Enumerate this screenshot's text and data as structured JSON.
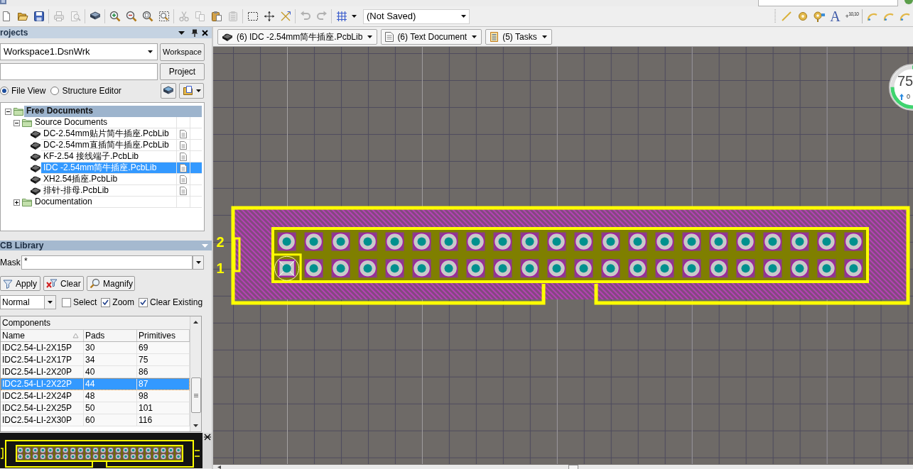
{
  "toolbar": {
    "buttons": [
      {
        "disabled": false
      },
      {
        "disabled": false
      },
      {
        "disabled": false
      },
      {
        "disabled": true
      },
      {
        "disabled": true
      },
      {
        "disabled": false
      },
      {
        "disabled": false
      },
      {
        "disabled": false
      },
      {
        "disabled": false
      },
      {
        "disabled": false
      },
      {
        "disabled": true
      },
      {
        "disabled": true
      },
      {
        "disabled": false
      },
      {
        "disabled": true
      },
      {
        "disabled": false
      },
      {
        "disabled": false
      },
      {
        "disabled": false
      },
      {
        "disabled": true
      },
      {
        "disabled": true
      },
      {
        "disabled": false
      }
    ],
    "document_combo": "(Not Saved)"
  },
  "place_toolbar": {
    "text_tool": "A",
    "coordinate_tool": "+$^{10,10}$"
  },
  "projects_panel": {
    "title": "rojects",
    "workspace_combo": "Workspace1.DsnWrk",
    "workspace_button": "Workspace",
    "project_button": "Project",
    "view_options": [
      {
        "label": "File View",
        "selected": true
      },
      {
        "label": "Structure Editor",
        "selected": false
      }
    ],
    "tree": [
      {
        "label": "Free Documents",
        "kind": "root",
        "expanded": true,
        "selected": false,
        "children": [
          {
            "label": "Source Documents",
            "kind": "folder",
            "expanded": true,
            "selected": false,
            "children": [
              {
                "label": "DC-2.54mm贴片简牛插座.PcbLib",
                "kind": "file",
                "selected": false
              },
              {
                "label": "DC-2.54mm直插简牛插座.PcbLib",
                "kind": "file",
                "selected": false
              },
              {
                "label": "KF-2.54 接线端子.PcbLib",
                "kind": "file",
                "selected": false
              },
              {
                "label": "IDC -2.54mm简牛插座.PcbLib",
                "kind": "file",
                "selected": true
              },
              {
                "label": "XH2.54插座.PcbLib",
                "kind": "file",
                "selected": false
              },
              {
                "label": "排针-排母.PcbLib",
                "kind": "file",
                "selected": false
              }
            ]
          },
          {
            "label": "Documentation",
            "kind": "folder",
            "expanded": false,
            "selected": false
          }
        ]
      }
    ]
  },
  "library_panel": {
    "title": "CB Library",
    "mask_label": "Mask",
    "mask_value": "*",
    "buttons": [
      {
        "label": "Apply",
        "kind": "apply"
      },
      {
        "label": "Clear",
        "kind": "clear"
      },
      {
        "label": "Magnify",
        "kind": "magnify"
      }
    ],
    "mode_combo": "Normal",
    "options": [
      {
        "label": "Select",
        "checked": false
      },
      {
        "label": "Zoom",
        "checked": true
      },
      {
        "label": "Clear Existing",
        "checked": true
      }
    ],
    "components": {
      "caption": "Components",
      "columns": [
        {
          "label": "Name",
          "sorted": true
        },
        {
          "label": "Pads",
          "sorted": false
        },
        {
          "label": "Primitives",
          "sorted": false
        }
      ],
      "rows": [
        {
          "cells": [
            "IDC2.54-LI-2X15P",
            "30",
            "69"
          ],
          "selected": false
        },
        {
          "cells": [
            "IDC2.54-LI-2X17P",
            "34",
            "75"
          ],
          "selected": false
        },
        {
          "cells": [
            "IDC2.54-LI-2X20P",
            "40",
            "86"
          ],
          "selected": false
        },
        {
          "cells": [
            "IDC2.54-LI-2X22P",
            "44",
            "87"
          ],
          "selected": true
        },
        {
          "cells": [
            "IDC2.54-LI-2X24P",
            "48",
            "98"
          ],
          "selected": false
        },
        {
          "cells": [
            "IDC2.54-LI-2X25P",
            "50",
            "101"
          ],
          "selected": false
        },
        {
          "cells": [
            "IDC2.54-LI-2X30P",
            "60",
            "116"
          ],
          "selected": false
        }
      ]
    }
  },
  "document_tabs": [
    {
      "label": "(6) IDC -2.54mm简牛插座.PcbLib",
      "kind": "pcblib"
    },
    {
      "label": "(6) Text Document",
      "kind": "text"
    },
    {
      "label": "(5) Tasks",
      "kind": "tasks"
    }
  ],
  "canvas": {
    "pad_rows": [
      {
        "label": "2",
        "pads": [
          {
            "kind": "round"
          },
          {
            "kind": "round"
          },
          {
            "kind": "round"
          },
          {
            "kind": "round"
          },
          {
            "kind": "round"
          },
          {
            "kind": "round"
          },
          {
            "kind": "round"
          },
          {
            "kind": "round"
          },
          {
            "kind": "round"
          },
          {
            "kind": "round"
          },
          {
            "kind": "round"
          },
          {
            "kind": "round"
          },
          {
            "kind": "round"
          },
          {
            "kind": "round"
          },
          {
            "kind": "round"
          },
          {
            "kind": "round"
          },
          {
            "kind": "round"
          },
          {
            "kind": "round"
          },
          {
            "kind": "round"
          },
          {
            "kind": "round"
          },
          {
            "kind": "round"
          },
          {
            "kind": "round"
          }
        ]
      },
      {
        "label": "1",
        "pads": [
          {
            "kind": "square"
          },
          {
            "kind": "round"
          },
          {
            "kind": "round"
          },
          {
            "kind": "round"
          },
          {
            "kind": "round"
          },
          {
            "kind": "round"
          },
          {
            "kind": "round"
          },
          {
            "kind": "round"
          },
          {
            "kind": "round"
          },
          {
            "kind": "round"
          },
          {
            "kind": "round"
          },
          {
            "kind": "round"
          },
          {
            "kind": "round"
          },
          {
            "kind": "round"
          },
          {
            "kind": "round"
          },
          {
            "kind": "round"
          },
          {
            "kind": "round"
          },
          {
            "kind": "round"
          },
          {
            "kind": "round"
          },
          {
            "kind": "round"
          },
          {
            "kind": "round"
          },
          {
            "kind": "round"
          }
        ]
      }
    ],
    "usage_widget": {
      "percent": "75",
      "rate": "0"
    }
  }
}
